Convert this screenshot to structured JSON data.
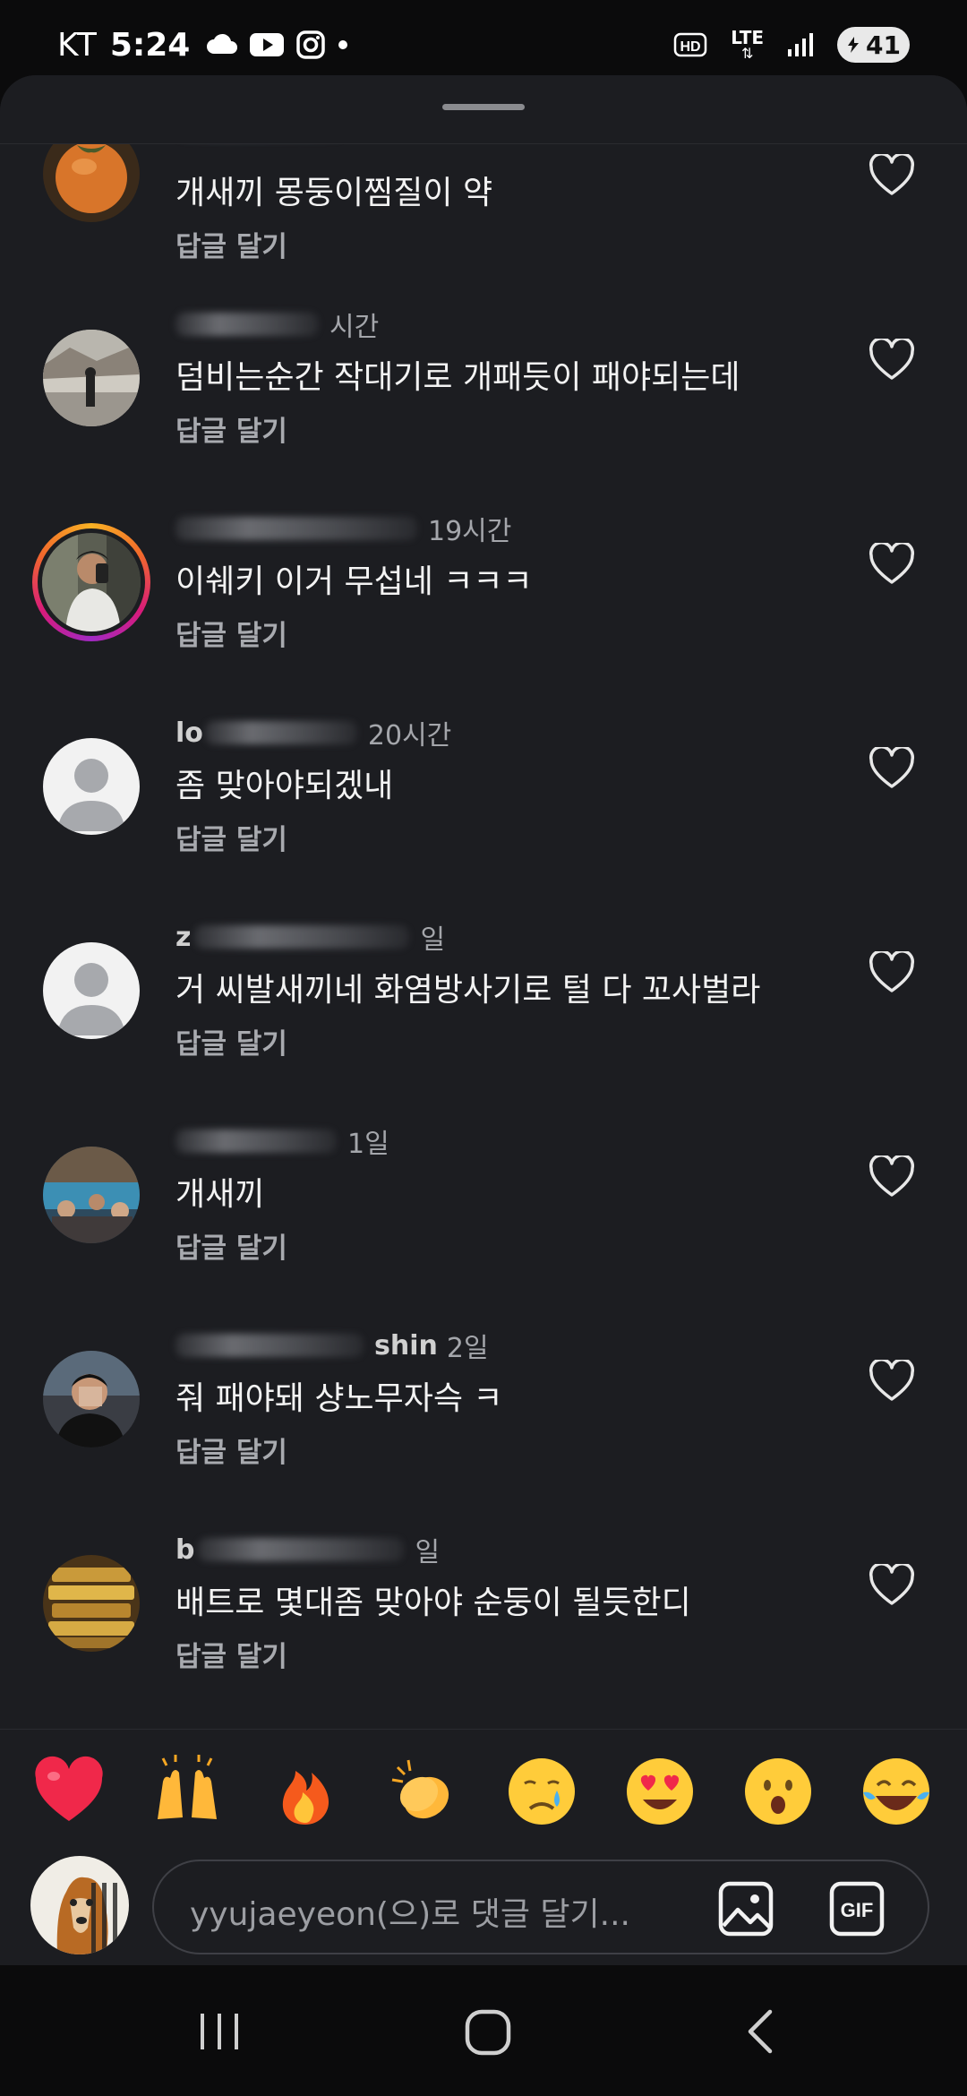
{
  "status_bar": {
    "carrier": "KT",
    "time": "5:24",
    "network": "LTE",
    "hd_label": "HD",
    "battery": "41",
    "icons": [
      "cloud-icon",
      "youtube-icon",
      "instagram-icon",
      "dot-icon",
      "hd-icon",
      "lte-icon",
      "signal-icon",
      "battery-icon"
    ]
  },
  "reply_label": "답글 달기",
  "comments": [
    {
      "time": "",
      "text": "개새끼 몽둥이찜질이 약",
      "avatar": "persimmon"
    },
    {
      "time": "시간",
      "text": "덤비는순간 작대기로 개패듯이 패야되는데",
      "avatar": "street-photo"
    },
    {
      "time": "19시간",
      "text": "이쉐키 이거 무섭네 ㅋㅋㅋ",
      "avatar": "person-story-ring"
    },
    {
      "time": "20시간",
      "text": "좀 맞아야되겠내",
      "avatar": "default"
    },
    {
      "time": "일",
      "text": "거 씨발새끼네 화염방사기로 털 다 꼬사벌라",
      "avatar": "default"
    },
    {
      "time": "1일",
      "text": "개새끼",
      "avatar": "group-photo"
    },
    {
      "time": "2일",
      "text": "줘 패야돼 샹노무자슥 ㅋ",
      "avatar": "person-dark"
    },
    {
      "time": "일",
      "text": "배트로 몇대좀 맞아야 순둥이 될듯한디",
      "avatar": "gold-bars"
    }
  ],
  "visible_username_fragments": [
    "lo",
    "z",
    "shin",
    "b"
  ],
  "emoji_bar": [
    "❤️",
    "🙌",
    "🔥",
    "👏",
    "😢",
    "😍",
    "😮",
    "😂"
  ],
  "comment_input": {
    "placeholder": "yyujaeyeon(으)로 댓글 달기..."
  },
  "nav": [
    "recent-apps-button",
    "home-button",
    "back-button"
  ],
  "colors": {
    "sheet_bg": "#1c1d21",
    "text": "#f3f3f3",
    "secondary_text": "#a4a6ab",
    "story_ring_start": "#f9b224",
    "story_ring_end": "#d81b7a"
  }
}
